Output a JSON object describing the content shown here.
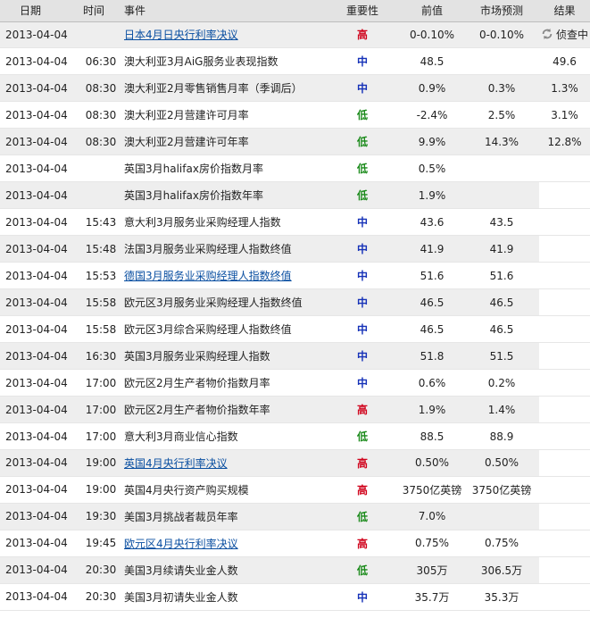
{
  "header": {
    "date": "日期",
    "time": "时间",
    "event": "事件",
    "importance": "重要性",
    "previous": "前值",
    "forecast": "市场预测",
    "result": "结果"
  },
  "colors": {
    "high": "#d0021b",
    "mid": "#1632b8",
    "low": "#1a8a1a",
    "link": "#0a4fa1"
  },
  "rows": [
    {
      "date": "2013-04-04",
      "time": "",
      "event": "日本4月日央行利率决议",
      "link": true,
      "importance": "高",
      "level": "high",
      "previous": "0-0.10%",
      "forecast": "0-0.10%",
      "result": "侦查中",
      "result_icon": "refresh-icon"
    },
    {
      "date": "2013-04-04",
      "time": "06:30",
      "event": "澳大利亚3月AiG服务业表现指数",
      "link": false,
      "importance": "中",
      "level": "mid",
      "previous": "48.5",
      "forecast": "",
      "result": "49.6"
    },
    {
      "date": "2013-04-04",
      "time": "08:30",
      "event": "澳大利亚2月零售销售月率（季调后）",
      "link": false,
      "importance": "中",
      "level": "mid",
      "previous": "0.9%",
      "forecast": "0.3%",
      "result": "1.3%"
    },
    {
      "date": "2013-04-04",
      "time": "08:30",
      "event": "澳大利亚2月营建许可月率",
      "link": false,
      "importance": "低",
      "level": "low",
      "previous": "-2.4%",
      "forecast": "2.5%",
      "result": "3.1%"
    },
    {
      "date": "2013-04-04",
      "time": "08:30",
      "event": "澳大利亚2月营建许可年率",
      "link": false,
      "importance": "低",
      "level": "low",
      "previous": "9.9%",
      "forecast": "14.3%",
      "result": "12.8%"
    },
    {
      "date": "2013-04-04",
      "time": "",
      "event": "英国3月halifax房价指数月率",
      "link": false,
      "importance": "低",
      "level": "low",
      "previous": "0.5%",
      "forecast": "",
      "result": ""
    },
    {
      "date": "2013-04-04",
      "time": "",
      "event": "英国3月halifax房价指数年率",
      "link": false,
      "importance": "低",
      "level": "low",
      "previous": "1.9%",
      "forecast": "",
      "result": ""
    },
    {
      "date": "2013-04-04",
      "time": "15:43",
      "event": "意大利3月服务业采购经理人指数",
      "link": false,
      "importance": "中",
      "level": "mid",
      "previous": "43.6",
      "forecast": "43.5",
      "result": ""
    },
    {
      "date": "2013-04-04",
      "time": "15:48",
      "event": "法国3月服务业采购经理人指数终值",
      "link": false,
      "importance": "中",
      "level": "mid",
      "previous": "41.9",
      "forecast": "41.9",
      "result": ""
    },
    {
      "date": "2013-04-04",
      "time": "15:53",
      "event": "德国3月服务业采购经理人指数终值",
      "link": true,
      "importance": "中",
      "level": "mid",
      "previous": "51.6",
      "forecast": "51.6",
      "result": ""
    },
    {
      "date": "2013-04-04",
      "time": "15:58",
      "event": "欧元区3月服务业采购经理人指数终值",
      "link": false,
      "importance": "中",
      "level": "mid",
      "previous": "46.5",
      "forecast": "46.5",
      "result": ""
    },
    {
      "date": "2013-04-04",
      "time": "15:58",
      "event": "欧元区3月综合采购经理人指数终值",
      "link": false,
      "importance": "中",
      "level": "mid",
      "previous": "46.5",
      "forecast": "46.5",
      "result": ""
    },
    {
      "date": "2013-04-04",
      "time": "16:30",
      "event": "英国3月服务业采购经理人指数",
      "link": false,
      "importance": "中",
      "level": "mid",
      "previous": "51.8",
      "forecast": "51.5",
      "result": ""
    },
    {
      "date": "2013-04-04",
      "time": "17:00",
      "event": "欧元区2月生产者物价指数月率",
      "link": false,
      "importance": "中",
      "level": "mid",
      "previous": "0.6%",
      "forecast": "0.2%",
      "result": ""
    },
    {
      "date": "2013-04-04",
      "time": "17:00",
      "event": "欧元区2月生产者物价指数年率",
      "link": false,
      "importance": "高",
      "level": "high",
      "previous": "1.9%",
      "forecast": "1.4%",
      "result": ""
    },
    {
      "date": "2013-04-04",
      "time": "17:00",
      "event": "意大利3月商业信心指数",
      "link": false,
      "importance": "低",
      "level": "low",
      "previous": "88.5",
      "forecast": "88.9",
      "result": ""
    },
    {
      "date": "2013-04-04",
      "time": "19:00",
      "event": "英国4月央行利率决议",
      "link": true,
      "importance": "高",
      "level": "high",
      "previous": "0.50%",
      "forecast": "0.50%",
      "result": ""
    },
    {
      "date": "2013-04-04",
      "time": "19:00",
      "event": "英国4月央行资产购买规模",
      "link": false,
      "importance": "高",
      "level": "high",
      "previous": "3750亿英镑",
      "forecast": "3750亿英镑",
      "result": ""
    },
    {
      "date": "2013-04-04",
      "time": "19:30",
      "event": "美国3月挑战者裁员年率",
      "link": false,
      "importance": "低",
      "level": "low",
      "previous": "7.0%",
      "forecast": "",
      "result": ""
    },
    {
      "date": "2013-04-04",
      "time": "19:45",
      "event": "欧元区4月央行利率决议",
      "link": true,
      "importance": "高",
      "level": "high",
      "previous": "0.75%",
      "forecast": "0.75%",
      "result": ""
    },
    {
      "date": "2013-04-04",
      "time": "20:30",
      "event": "美国3月续请失业金人数",
      "link": false,
      "importance": "低",
      "level": "low",
      "previous": "305万",
      "forecast": "306.5万",
      "result": ""
    },
    {
      "date": "2013-04-04",
      "time": "20:30",
      "event": "美国3月初请失业金人数",
      "link": false,
      "importance": "中",
      "level": "mid",
      "previous": "35.7万",
      "forecast": "35.3万",
      "result": ""
    }
  ]
}
